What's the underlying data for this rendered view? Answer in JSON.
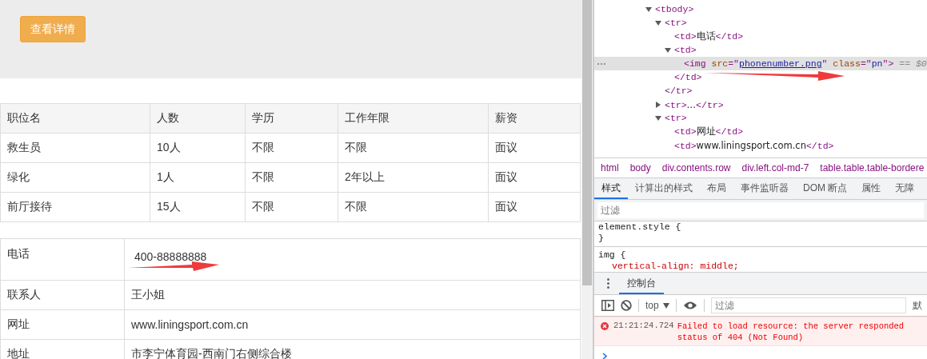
{
  "page": {
    "details_button": "查看详情",
    "jobs_table": {
      "columns": [
        "职位名",
        "人数",
        "学历",
        "工作年限",
        "薪资"
      ],
      "rows": [
        [
          "救生员",
          "10人",
          "不限",
          "不限",
          "面议"
        ],
        [
          "绿化",
          "1人",
          "不限",
          "2年以上",
          "面议"
        ],
        [
          "前厅接待",
          "15人",
          "不限",
          "不限",
          "面议"
        ]
      ]
    },
    "contact_table": {
      "rows": [
        {
          "label": "电话",
          "value": "400-88888888"
        },
        {
          "label": "联系人",
          "value": "王小姐"
        },
        {
          "label": "网址",
          "value": "www.liningsport.com.cn"
        },
        {
          "label": "地址",
          "value": "市李宁体育园-西南门右侧综合楼"
        }
      ]
    }
  },
  "devtools": {
    "dom_tree": [
      {
        "parts": [
          {
            "kind": "tag",
            "text": "<tbody>"
          }
        ],
        "expanded": true,
        "selected": false,
        "children": [
          {
            "parts": [
              {
                "kind": "tag",
                "text": "<tr>"
              }
            ],
            "expanded": true,
            "selected": false,
            "close": [
              {
                "kind": "tag",
                "text": "</tr>"
              }
            ],
            "children": [
              {
                "parts": [
                  {
                    "kind": "tag",
                    "text": "<td>"
                  },
                  {
                    "kind": "text",
                    "text": "电话"
                  },
                  {
                    "kind": "tag",
                    "text": "</td>"
                  }
                ],
                "selected": false
              },
              {
                "parts": [
                  {
                    "kind": "tag",
                    "text": "<td>"
                  }
                ],
                "expanded": true,
                "selected": false,
                "close": [
                  {
                    "kind": "tag",
                    "text": "</td>"
                  }
                ],
                "children": [
                  {
                    "parts": [
                      {
                        "kind": "tag",
                        "text": "<img"
                      },
                      {
                        "kind": "attr",
                        "text": " src"
                      },
                      {
                        "kind": "tag",
                        "text": "=\""
                      },
                      {
                        "kind": "link",
                        "text": "phonenumber.png"
                      },
                      {
                        "kind": "tag",
                        "text": "\""
                      },
                      {
                        "kind": "attr",
                        "text": " class"
                      },
                      {
                        "kind": "tag",
                        "text": "=\""
                      },
                      {
                        "kind": "value",
                        "text": "pn"
                      },
                      {
                        "kind": "tag",
                        "text": "\">"
                      },
                      {
                        "kind": "ref",
                        "text": " == $0"
                      }
                    ],
                    "selected": true
                  }
                ]
              }
            ]
          },
          {
            "parts": [
              {
                "kind": "tag",
                "text": "<tr>"
              },
              {
                "kind": "text",
                "text": "…"
              },
              {
                "kind": "tag",
                "text": "</tr>"
              }
            ],
            "expanded": false,
            "selected": false
          },
          {
            "parts": [
              {
                "kind": "tag",
                "text": "<tr>"
              }
            ],
            "expanded": true,
            "selected": false,
            "children": [
              {
                "parts": [
                  {
                    "kind": "tag",
                    "text": "<td>"
                  },
                  {
                    "kind": "text",
                    "text": "网址"
                  },
                  {
                    "kind": "tag",
                    "text": "</td>"
                  }
                ],
                "selected": false
              },
              {
                "parts": [
                  {
                    "kind": "tag",
                    "text": "<td>"
                  },
                  {
                    "kind": "text",
                    "text": "www.liningsport.com.cn"
                  },
                  {
                    "kind": "tag",
                    "text": "</td>"
                  }
                ],
                "selected": false
              }
            ]
          }
        ]
      }
    ],
    "breadcrumbs": [
      "html",
      "body",
      "div.contents.row",
      "div.left.col-md-7",
      "table.table.table-bordere"
    ],
    "tabs": [
      {
        "label": "样式",
        "selected": true
      },
      {
        "label": "计算出的样式",
        "selected": false
      },
      {
        "label": "布局",
        "selected": false
      },
      {
        "label": "事件监听器",
        "selected": false
      },
      {
        "label": "DOM 断点",
        "selected": false
      },
      {
        "label": "属性",
        "selected": false
      },
      {
        "label": "无障",
        "selected": false
      }
    ],
    "styles_filter": {
      "placeholder": "过滤"
    },
    "style_lines": [
      {
        "kind": "selector",
        "text": "element.style {"
      },
      {
        "kind": "brace",
        "text": "}"
      },
      {
        "kind": "selector",
        "text": "img {"
      },
      {
        "kind": "property",
        "text": "vertical-align: middle;"
      }
    ],
    "drawer_tabs": [
      {
        "label": "控制台",
        "selected": true
      }
    ],
    "console_toolbar": {
      "context": "top",
      "filter_placeholder": "过滤",
      "levels": "默"
    },
    "messages": [
      {
        "kind": "error",
        "time": "21:21:24.724",
        "lines": [
          "Failed to load resource: the server responded",
          "status of 404 (Not Found)"
        ]
      }
    ]
  }
}
